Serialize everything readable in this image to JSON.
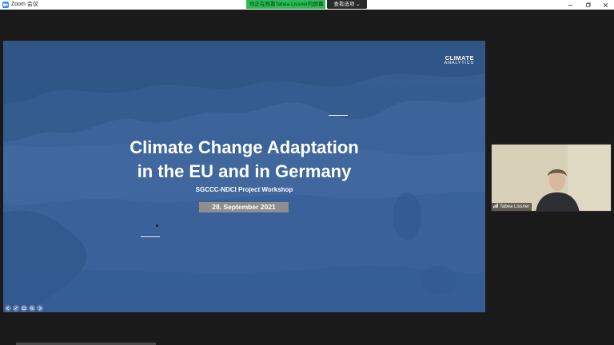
{
  "window": {
    "app_title": "Zoom 会议",
    "share_banner": "你正在观看Tabea Lissner的屏幕",
    "view_options": "查看选项",
    "controls": [
      "minimize-icon",
      "maximize-icon",
      "close-icon"
    ]
  },
  "slide": {
    "brand_line1": "CLIMATE",
    "brand_line2": "ANALYTICS",
    "title_line1": "Climate Change Adaptation",
    "title_line2": "in the EU and in Germany",
    "subtitle": "SGCCC-NDCI Project Workshop",
    "date": "28. September 2021",
    "tools": [
      "prev-arrow-icon",
      "pen-icon",
      "slides-icon",
      "zoom-icon",
      "next-arrow-icon"
    ]
  },
  "participant": {
    "name": "Tabea Lissner",
    "mic_icon": "signal-bars-icon"
  },
  "colors": {
    "slide_bg": "#3b639a",
    "share_banner": "#2bbd55",
    "date_box": "#8e8e8e",
    "zoom_blue": "#2d8cff"
  }
}
